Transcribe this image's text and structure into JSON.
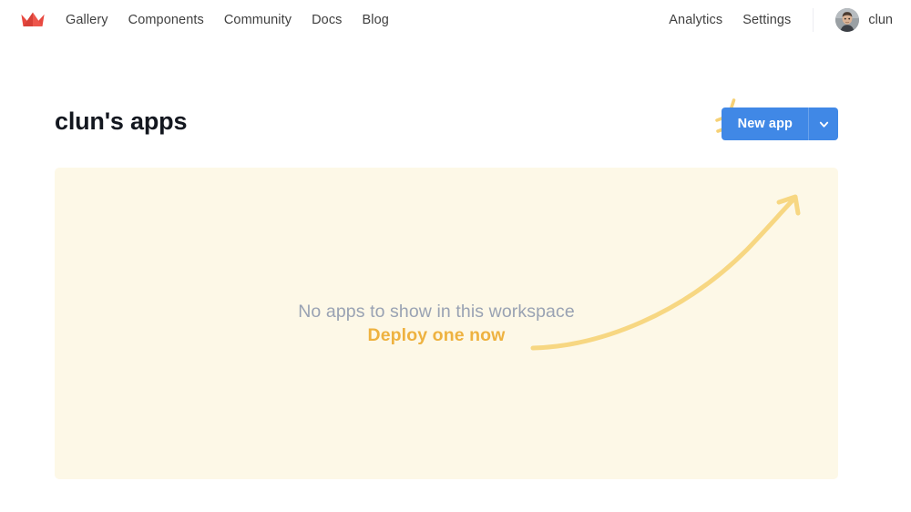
{
  "nav": {
    "logo_icon": "crown-icon",
    "logo_color": "#e8483f",
    "links": [
      {
        "label": "Gallery"
      },
      {
        "label": "Components"
      },
      {
        "label": "Community"
      },
      {
        "label": "Docs"
      },
      {
        "label": "Blog"
      }
    ],
    "right_links": [
      {
        "label": "Analytics"
      },
      {
        "label": "Settings"
      }
    ],
    "user": {
      "name": "clun",
      "avatar_icon": "user-avatar-photo"
    }
  },
  "header": {
    "title": "clun's apps",
    "new_app": {
      "label": "New app",
      "caret_icon": "chevron-down-icon",
      "color": "#4088e6",
      "text_color": "#ffffff"
    },
    "sparkle_icon": "sparkle-lines-icon",
    "sparkle_color": "#f6d176"
  },
  "empty_state": {
    "panel_color": "#fdf8e7",
    "message": "No apps to show in this workspace",
    "message_color": "#99a2b3",
    "cta": "Deploy one now",
    "cta_color": "#eeb240",
    "arrow_icon": "curved-up-arrow-icon",
    "arrow_color": "#f7d782"
  }
}
